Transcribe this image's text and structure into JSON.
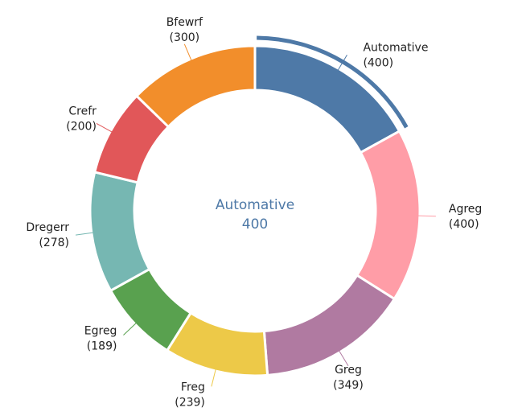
{
  "chart_data": {
    "type": "pie",
    "variant": "donut",
    "categories": [
      "Automative",
      "Agreg",
      "Greg",
      "Freg",
      "Egreg",
      "Dregerr",
      "Crefr",
      "Bfewrf"
    ],
    "values": [
      400,
      400,
      349,
      239,
      189,
      278,
      200,
      300
    ],
    "colors": [
      "#4e79a7",
      "#ff9da7",
      "#b07aa1",
      "#edc948",
      "#59a14f",
      "#76b7b2",
      "#e15759",
      "#f28e2b"
    ],
    "highlighted": "Automative",
    "center_label": {
      "name": "Automative",
      "value": "400"
    },
    "labels": [
      {
        "name": "Automative",
        "value_text": "(400)"
      },
      {
        "name": "Agreg",
        "value_text": "(400)"
      },
      {
        "name": "Greg",
        "value_text": "(349)"
      },
      {
        "name": "Freg",
        "value_text": "(239)"
      },
      {
        "name": "Egreg",
        "value_text": "(189)"
      },
      {
        "name": "Dregerr",
        "value_text": "(278)"
      },
      {
        "name": "Crefr",
        "value_text": "(200)"
      },
      {
        "name": "Bfewrf",
        "value_text": "(300)"
      }
    ]
  }
}
